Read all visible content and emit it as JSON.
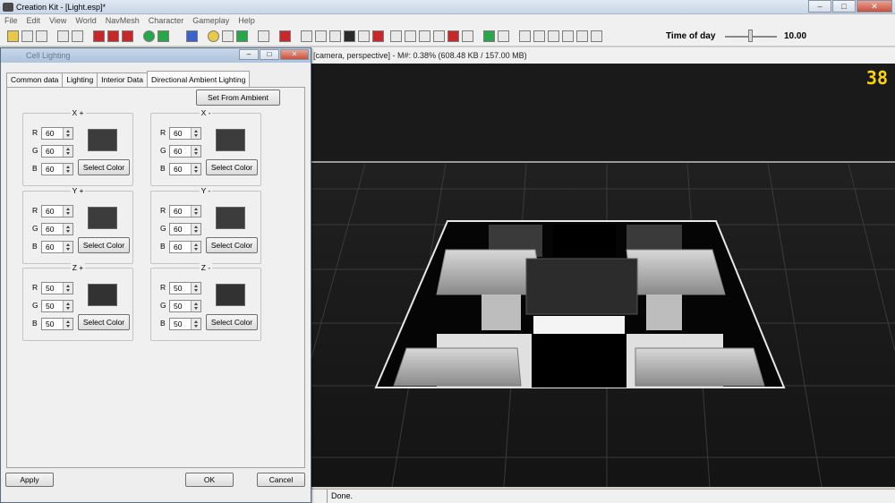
{
  "window": {
    "title": "Creation Kit - [Light.esp]*",
    "buttons": [
      "–",
      "□",
      "✕"
    ]
  },
  "menu": [
    "File",
    "Edit",
    "View",
    "World",
    "NavMesh",
    "Character",
    "Gameplay",
    "Help"
  ],
  "toolbar": {
    "time_of_day_label": "Time of day",
    "time_of_day_value": "10.00"
  },
  "viewport": {
    "info": "[camera, perspective] - M#: 0.38% (608.48 KB / 157.00 MB)",
    "fps": "38"
  },
  "statusbar": {
    "text": "Done."
  },
  "dialog": {
    "title": "Cell Lighting",
    "tabs": [
      "Common data",
      "Lighting",
      "Interior Data",
      "Directional Ambient Lighting"
    ],
    "set_from_ambient": "Set From Ambient",
    "channel_labels": {
      "r": "R",
      "g": "G",
      "b": "B"
    },
    "select_color": "Select Color",
    "groups": [
      {
        "label": "X +",
        "r": "60",
        "g": "60",
        "b": "60",
        "color": "#3c3c3c"
      },
      {
        "label": "X -",
        "r": "60",
        "g": "60",
        "b": "60",
        "color": "#3c3c3c"
      },
      {
        "label": "Y +",
        "r": "60",
        "g": "60",
        "b": "60",
        "color": "#3c3c3c"
      },
      {
        "label": "Y -",
        "r": "60",
        "g": "60",
        "b": "60",
        "color": "#3c3c3c"
      },
      {
        "label": "Z +",
        "r": "50",
        "g": "50",
        "b": "50",
        "color": "#323232"
      },
      {
        "label": "Z -",
        "r": "50",
        "g": "50",
        "b": "50",
        "color": "#323232"
      }
    ],
    "apply": "Apply",
    "ok": "OK",
    "cancel": "Cancel"
  }
}
